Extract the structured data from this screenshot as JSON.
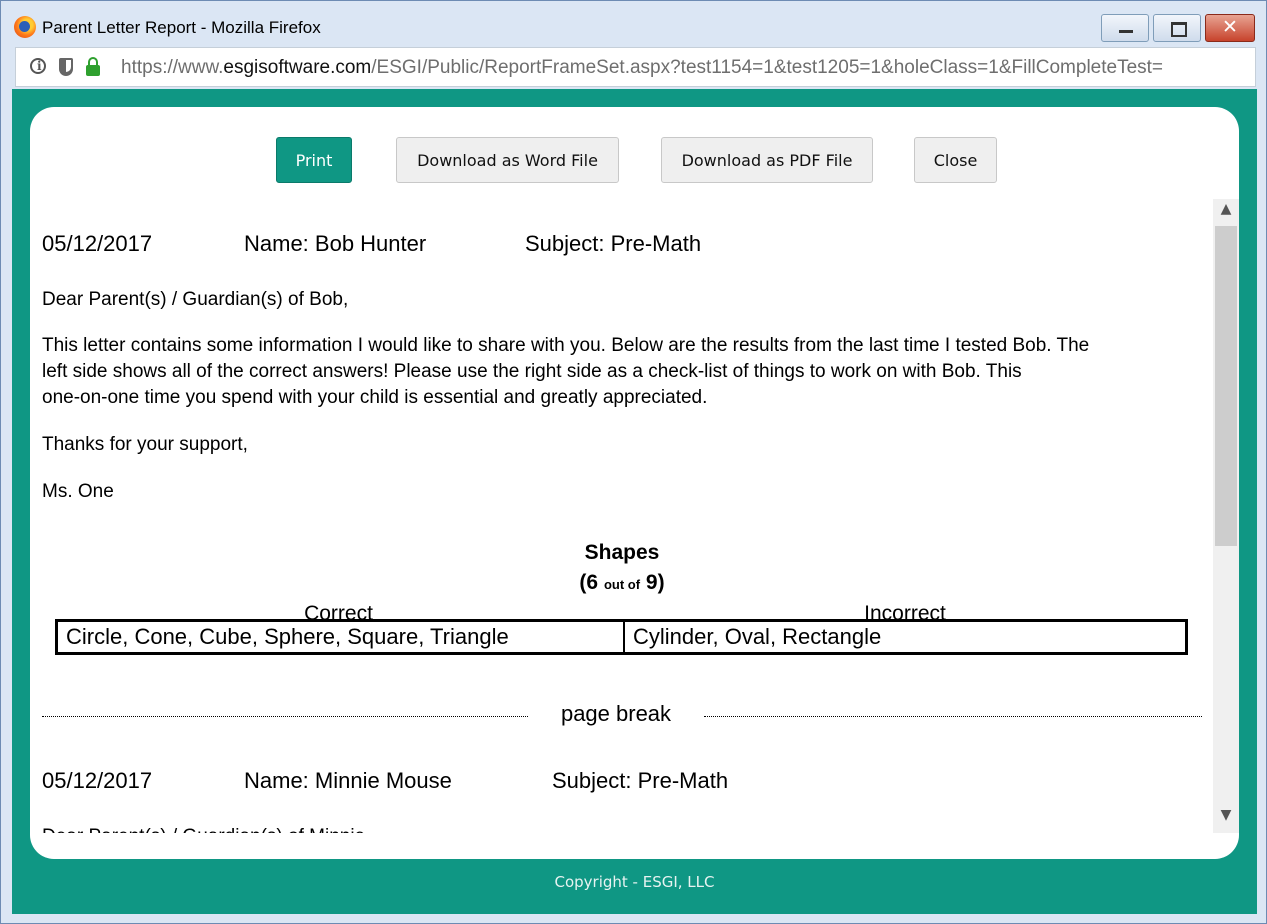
{
  "window": {
    "title": "Parent Letter Report - Mozilla Firefox",
    "url_prefix": "https://www.",
    "url_host": "esgisoftware.com",
    "url_path": "/ESGI/Public/ReportFrameSet.aspx?test1154=1&test1205=1&holeClass=1&FillCompleteTest="
  },
  "toolbar": {
    "print_label": "Print",
    "word_label": "Download as Word File",
    "pdf_label": "Download as PDF File",
    "close_label": "Close"
  },
  "letters": [
    {
      "date": "05/12/2017",
      "name": "Name: Bob Hunter",
      "subject": "Subject: Pre-Math",
      "greeting": "Dear Parent(s) / Guardian(s) of Bob,",
      "body_line1": "This letter contains some information I would like to share with you. Below are the results from the last time I tested Bob. The",
      "body_line2": "left side shows all of the correct answers! Please use the right side as a check-list of things to work on with Bob. This",
      "body_line3": "one-on-one time you spend with your child is essential and greatly appreciated.",
      "thanks": "Thanks for your support,",
      "signature": "Ms. One",
      "test": {
        "title": "Shapes",
        "score_open": "(6",
        "score_out_of": "out of",
        "score_close": "9)",
        "correct_label": "Correct",
        "incorrect_label": "Incorrect",
        "correct": "Circle, Cone, Cube, Sphere, Square, Triangle",
        "incorrect": "Cylinder, Oval, Rectangle"
      }
    },
    {
      "date": "05/12/2017",
      "name": "Name: Minnie Mouse",
      "subject": "Subject: Pre-Math",
      "greeting": "Dear Parent(s) / Guardian(s) of Minnie,"
    }
  ],
  "page_break_label": "page break",
  "footer": "Copyright - ESGI, LLC",
  "colors": {
    "accent": "#0f9784"
  }
}
